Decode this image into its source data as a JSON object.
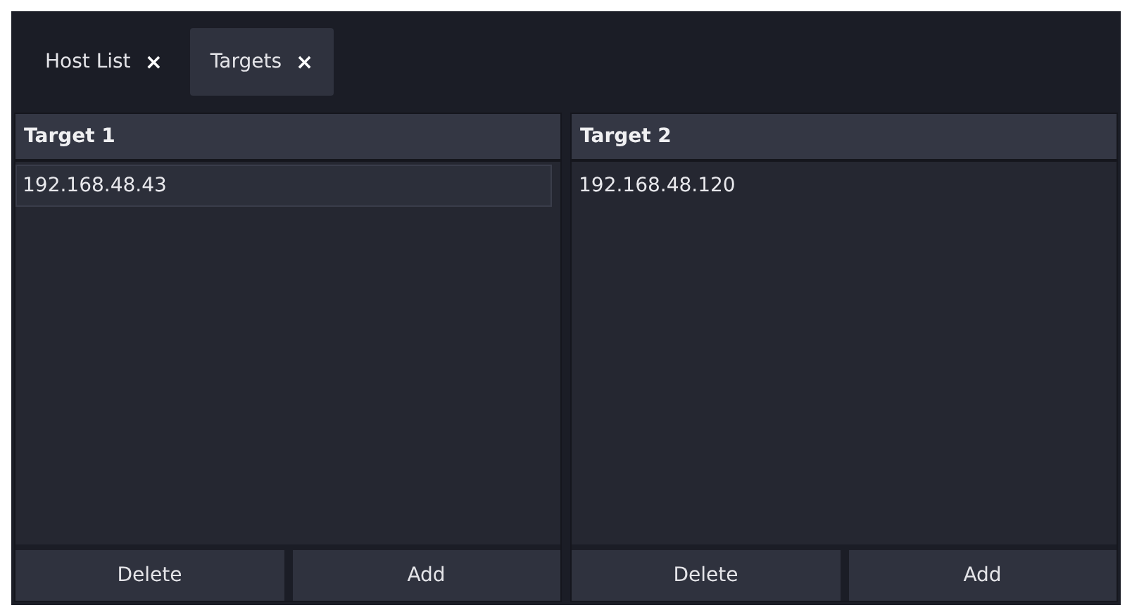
{
  "tabs": [
    {
      "label": "Host List",
      "close": "×",
      "selected": false
    },
    {
      "label": "Targets",
      "close": "×",
      "selected": true
    }
  ],
  "panels": [
    {
      "title": "Target 1",
      "rows": [
        {
          "text": "192.168.48.43",
          "selected": true
        }
      ],
      "buttons": [
        "Delete",
        "Add"
      ]
    },
    {
      "title": "Target 2",
      "rows": [
        {
          "text": "192.168.48.120",
          "selected": false
        }
      ],
      "buttons": [
        "Delete",
        "Add"
      ]
    }
  ]
}
